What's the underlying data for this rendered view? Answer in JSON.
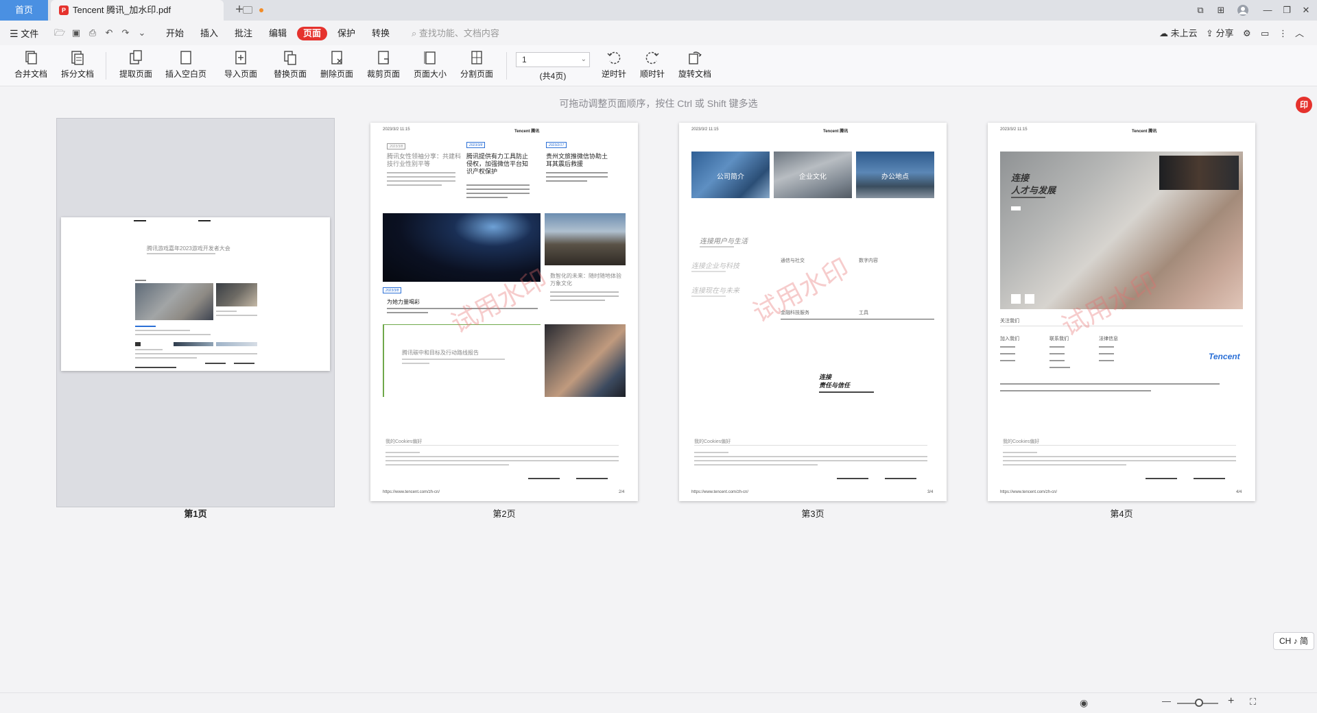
{
  "tabs": {
    "home": "首页",
    "doc_title": "Tencent 腾讯_加水印.pdf",
    "add": "+"
  },
  "window": {
    "layout": "⧉",
    "grid": "⊞",
    "minimize": "—",
    "restore": "❐",
    "close": "✕"
  },
  "menu": {
    "file": "文件",
    "items": [
      "开始",
      "插入",
      "批注",
      "编辑",
      "页面",
      "保护",
      "转换"
    ],
    "active": "页面",
    "search_placeholder": "查找功能、文档内容",
    "cloud": "未上云",
    "share": "分享"
  },
  "ribbon": {
    "merge": "合并文档",
    "split": "拆分文档",
    "extract": "提取页面",
    "insert_blank": "插入空白页",
    "import": "导入页面",
    "replace": "替换页面",
    "delete": "删除页面",
    "crop": "裁剪页面",
    "size": "页面大小",
    "divide": "分割页面",
    "page_value": "1",
    "page_total": "(共4页)",
    "ccw": "逆时针",
    "cw": "顺时针",
    "rotate_doc": "旋转文档"
  },
  "main": {
    "hint": "可拖动调整页面顺序，按住 Ctrl 或 Shift 键多选",
    "stamp": "印",
    "watermark": "试用水印",
    "pages": [
      {
        "label": "第1页"
      },
      {
        "label": "第2页"
      },
      {
        "label": "第3页"
      },
      {
        "label": "第4页"
      }
    ],
    "p1": {
      "title": "腾讯游戏嘉年2023游戏开发者大会"
    },
    "p2": {
      "date": "2023/3/2 11:15",
      "header": "Tencent 腾讯",
      "col1_title": "腾讯女性领袖分享：共建科技行业性别平等",
      "col2_title": "腾讯提供有力工具防止侵权，加强微信平台知识产权保护",
      "col3_title": "贵州文旅推微信协助土耳其震后救援",
      "mid_title": "为她力量喝彩",
      "mid_right_title": "数智化的未来：随时随地体验万象文化",
      "report_title": "腾讯碳中和目标及行动路线报告",
      "cookies": "我的Cookies偏好",
      "url": "https://www.tencent.com/zh-cn/",
      "num": "2/4"
    },
    "p3": {
      "date": "2023/3/2 11:15",
      "header": "Tencent 腾讯",
      "img1": "公司简介",
      "img2": "企业文化",
      "img3": "办公地点",
      "link1": "连接用户与生活",
      "link2": "连接企业与科技",
      "link3": "连接现在与未来",
      "cat1": "通信与社交",
      "cat2": "数字内容",
      "cat3": "金融科技服务",
      "cat4": "工具",
      "conn": "连接",
      "resp": "责任与信任",
      "cookies": "我的Cookies偏好",
      "url": "https://www.tencent.com/zh-cn/",
      "num": "3/4"
    },
    "p4": {
      "date": "2023/3/2 11:15",
      "header": "Tencent 腾讯",
      "hero1": "连接",
      "hero2": "人才与发展",
      "follow": "关注我们",
      "join": "加入我们",
      "contact": "联系我们",
      "legal": "法律信息",
      "brand": "Tencent",
      "cookies": "我的Cookies偏好",
      "url": "https://www.tencent.com/zh-cn/",
      "num": "4/4"
    }
  },
  "status": {
    "ime": "CH ♪ 简",
    "zoom_minus": "—",
    "zoom_plus": "+"
  },
  "colors": {
    "accent": "#e5322d",
    "tab_blue": "#4a90e2",
    "link_blue": "#2a6fd6"
  }
}
